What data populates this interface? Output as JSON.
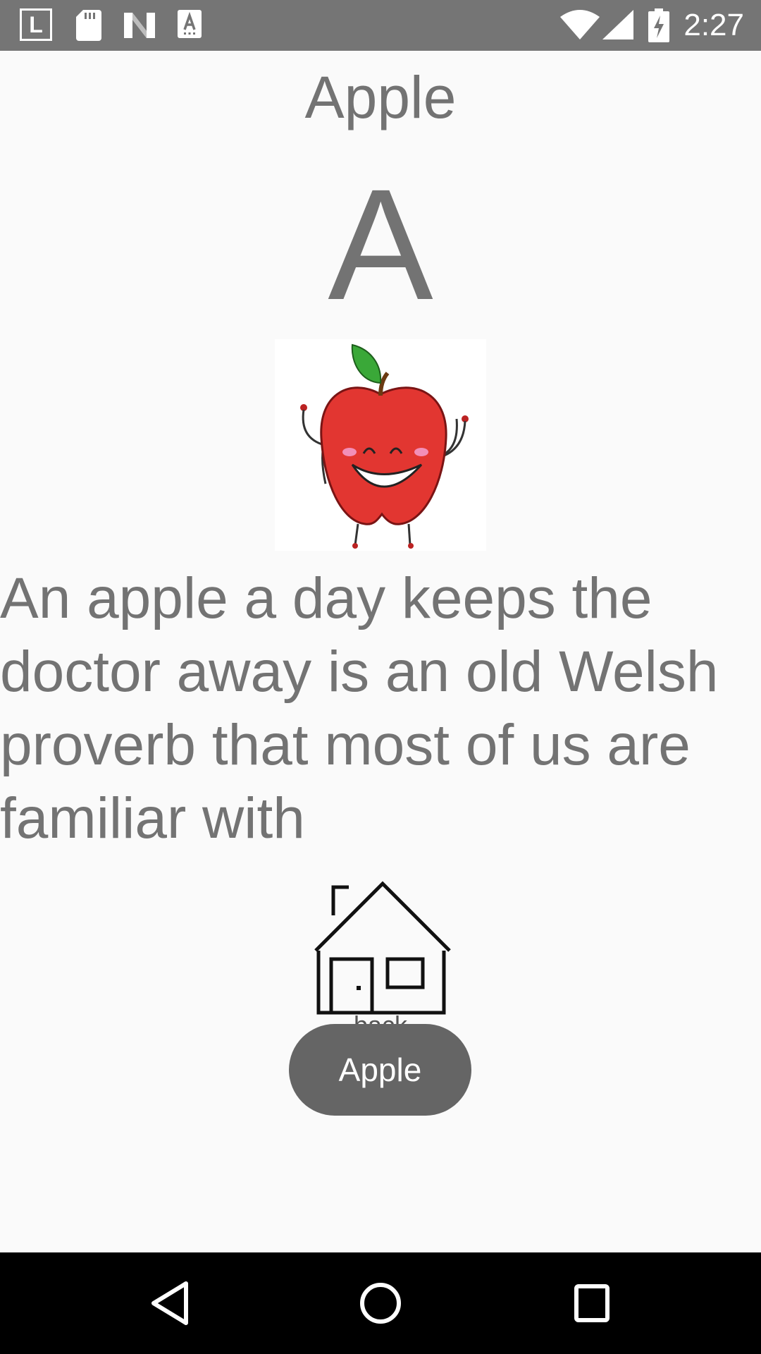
{
  "status_bar": {
    "left_icons": [
      "launcher-l-icon",
      "sd-card-icon",
      "n-logo-icon",
      "text-a-icon"
    ],
    "l_label": "L",
    "right_icons": [
      "wifi-icon",
      "signal-icon",
      "battery-charging-icon"
    ],
    "time": "2:27",
    "background": "#757575"
  },
  "content": {
    "title": "Apple",
    "letter": "A",
    "image_icon": "smiling-apple-icon",
    "description": "An apple a day keeps the doctor away is an old Welsh proverb that most of us are familiar with",
    "home_button_icon": "house-icon",
    "back_label": "back",
    "text_color": "#737373"
  },
  "toast": {
    "text": "Apple",
    "background": "#656565"
  },
  "nav_bar": {
    "buttons": [
      "back-triangle-icon",
      "home-circle-icon",
      "recents-square-icon"
    ],
    "background": "#000000"
  }
}
